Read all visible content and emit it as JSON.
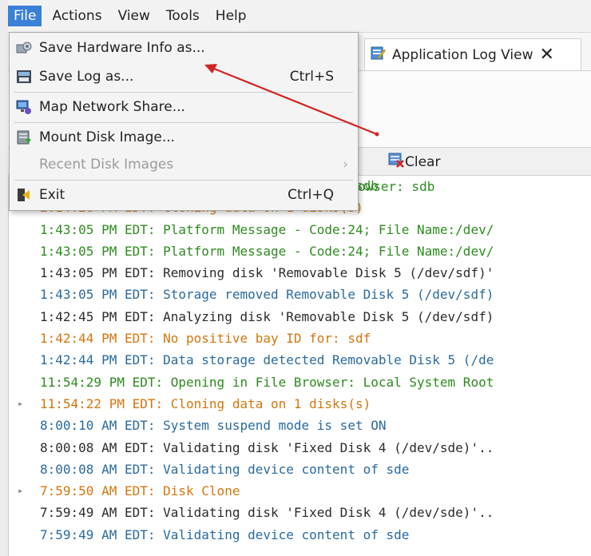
{
  "menubar": {
    "items": [
      "File",
      "Actions",
      "View",
      "Tools",
      "Help"
    ]
  },
  "tab": {
    "label": "Application Log View",
    "close": "✕"
  },
  "clear_label": "Clear",
  "file_menu": {
    "save_hw": "Save Hardware Info as...",
    "save_log": "Save Log as...",
    "save_log_shortcut": "Ctrl+S",
    "map_share": "Map Network Share...",
    "mount_disk": "Mount Disk Image...",
    "recent": "Recent Disk Images",
    "recent_arrow": "›",
    "exit": "Exit",
    "exit_shortcut": "Ctrl+Q"
  },
  "log_partial_top": "owser: sdb",
  "log": [
    {
      "text": "2:37:35 PM EDT: Opening in File Browser: sdb",
      "color": "green",
      "expand": false
    },
    {
      "text": "2:14:28 PM EDT: Cloning data on 1 disks(s)",
      "color": "orange",
      "expand": true
    },
    {
      "text": "1:43:05 PM EDT: Platform Message - Code:24; File Name:/dev/",
      "color": "green",
      "expand": false
    },
    {
      "text": "1:43:05 PM EDT: Platform Message - Code:24; File Name:/dev/",
      "color": "green",
      "expand": false
    },
    {
      "text": "1:43:05 PM EDT: Removing disk 'Removable Disk 5 (/dev/sdf)'",
      "color": "dark",
      "expand": false
    },
    {
      "text": "1:43:05 PM EDT: Storage removed Removable Disk 5 (/dev/sdf)",
      "color": "blue",
      "expand": false
    },
    {
      "text": "1:42:45 PM EDT: Analyzing disk 'Removable Disk 5 (/dev/sdf)",
      "color": "dark",
      "expand": false
    },
    {
      "text": "1:42:44 PM EDT: No positive bay ID for: sdf",
      "color": "orange",
      "expand": false
    },
    {
      "text": "1:42:44 PM EDT: Data storage detected Removable Disk 5 (/de",
      "color": "blue",
      "expand": false
    },
    {
      "text": "11:54:29 PM EDT: Opening in File Browser: Local System Root",
      "color": "green",
      "expand": false
    },
    {
      "text": "11:54:22 PM EDT: Cloning data on 1 disks(s)",
      "color": "orange",
      "expand": true
    },
    {
      "text": "8:00:10 AM EDT: System suspend mode is set ON",
      "color": "blue",
      "expand": false
    },
    {
      "text": "8:00:08 AM EDT: Validating disk 'Fixed Disk 4 (/dev/sde)'..",
      "color": "dark",
      "expand": false
    },
    {
      "text": "8:00:08 AM EDT: Validating device content of sde",
      "color": "blue",
      "expand": false
    },
    {
      "text": "7:59:50 AM EDT: Disk Clone",
      "color": "orange",
      "expand": true
    },
    {
      "text": "7:59:49 AM EDT: Validating disk 'Fixed Disk 4 (/dev/sde)'..",
      "color": "dark",
      "expand": false
    },
    {
      "text": "7:59:49 AM EDT: Validating device content of sde",
      "color": "blue",
      "expand": false
    }
  ],
  "colors": {
    "green": "#2e8b1f",
    "blue": "#2a6a9e",
    "orange": "#d4760c",
    "dark": "#2b2b2b",
    "menu_active": "#3a80d8",
    "annotation_arrow": "#d42222"
  }
}
